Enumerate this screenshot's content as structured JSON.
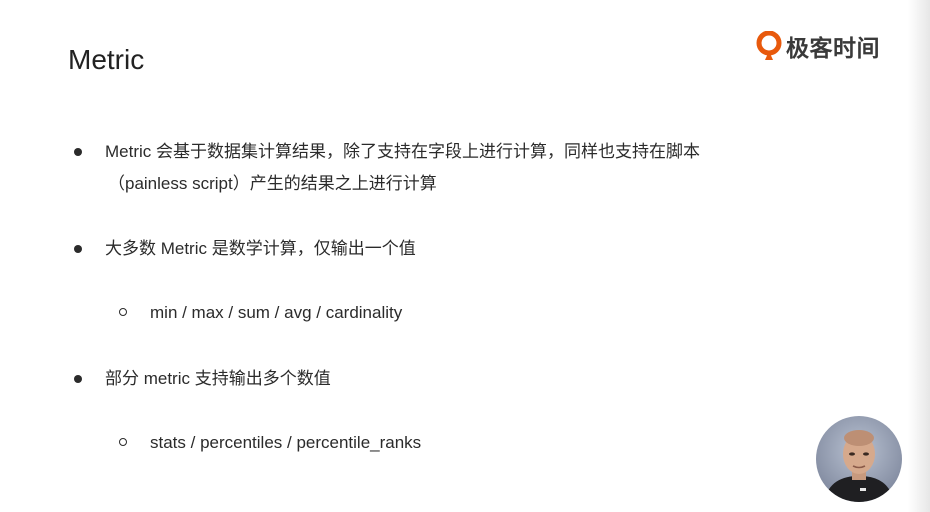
{
  "slide": {
    "title": "Metric",
    "logo_text": "极客时间",
    "bullets": [
      {
        "line1": "Metric 会基于数据集计算结果，除了支持在字段上进行计算，同样也支持在脚本",
        "line2": "（painless script）产生的结果之上进行计算"
      },
      {
        "line1": "大多数 Metric 是数学计算，仅输出一个值",
        "sub": "min / max / sum / avg / cardinality"
      },
      {
        "line1": "部分 metric 支持输出多个数值",
        "sub": "stats / percentiles / percentile_ranks"
      }
    ]
  },
  "colors": {
    "brand_orange": "#e8590c",
    "text": "#2b2b2b"
  },
  "icons": {
    "logo": "geektime-logo-icon",
    "presenter": "presenter-avatar"
  }
}
